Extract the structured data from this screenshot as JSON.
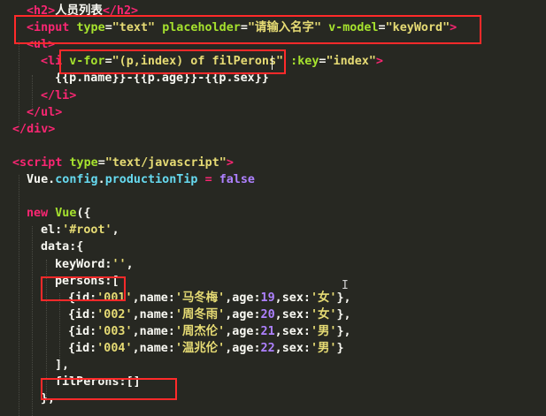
{
  "editor": {
    "lines": [
      [
        {
          "c": "tag",
          "t": "<h2>"
        },
        {
          "c": "plain",
          "t": "人员列表"
        },
        {
          "c": "tag",
          "t": "</h2>"
        }
      ],
      [
        {
          "c": "tag",
          "t": "<input"
        },
        {
          "c": "plain",
          "t": " "
        },
        {
          "c": "attr",
          "t": "type"
        },
        {
          "c": "plain",
          "t": "="
        },
        {
          "c": "str",
          "t": "\"text\""
        },
        {
          "c": "plain",
          "t": " "
        },
        {
          "c": "attr",
          "t": "placeholder"
        },
        {
          "c": "plain",
          "t": "="
        },
        {
          "c": "str",
          "t": "\"请输入名字\""
        },
        {
          "c": "plain",
          "t": " "
        },
        {
          "c": "attr",
          "t": "v-model"
        },
        {
          "c": "plain",
          "t": "="
        },
        {
          "c": "str",
          "t": "\"keyWord\""
        },
        {
          "c": "tag",
          "t": ">"
        }
      ],
      [
        {
          "c": "tag",
          "t": "<ul>"
        }
      ],
      [
        {
          "c": "tag",
          "t": "<li"
        },
        {
          "c": "plain",
          "t": " "
        },
        {
          "c": "attr",
          "t": "v-for"
        },
        {
          "c": "plain",
          "t": "="
        },
        {
          "c": "str",
          "t": "\"(p,index) of filPerons\""
        },
        {
          "c": "plain",
          "t": " "
        },
        {
          "c": "attr",
          "t": ":key"
        },
        {
          "c": "plain",
          "t": "="
        },
        {
          "c": "str",
          "t": "\"index\""
        },
        {
          "c": "tag",
          "t": ">"
        }
      ],
      [
        {
          "c": "plain",
          "t": "{{p.name}}-{{p.age}}-{{p.sex}}"
        }
      ],
      [
        {
          "c": "tag",
          "t": "</li>"
        }
      ],
      [
        {
          "c": "tag",
          "t": "</ul>"
        }
      ],
      [
        {
          "c": "tag",
          "t": "</div>"
        }
      ],
      [],
      [
        {
          "c": "tag",
          "t": "<script"
        },
        {
          "c": "plain",
          "t": " "
        },
        {
          "c": "attr",
          "t": "type"
        },
        {
          "c": "plain",
          "t": "="
        },
        {
          "c": "str",
          "t": "\"text/javascript\""
        },
        {
          "c": "tag",
          "t": ">"
        }
      ],
      [
        {
          "c": "plain",
          "t": "Vue."
        },
        {
          "c": "obj",
          "t": "config"
        },
        {
          "c": "plain",
          "t": "."
        },
        {
          "c": "obj",
          "t": "productionTip"
        },
        {
          "c": "plain",
          "t": " "
        },
        {
          "c": "kw",
          "t": "="
        },
        {
          "c": "plain",
          "t": " "
        },
        {
          "c": "num",
          "t": "false"
        }
      ],
      [],
      [
        {
          "c": "kw",
          "t": "new"
        },
        {
          "c": "plain",
          "t": " "
        },
        {
          "c": "fn",
          "t": "Vue"
        },
        {
          "c": "plain",
          "t": "({"
        }
      ],
      [
        {
          "c": "plain",
          "t": "el:"
        },
        {
          "c": "str",
          "t": "'#root'"
        },
        {
          "c": "plain",
          "t": ","
        }
      ],
      [
        {
          "c": "plain",
          "t": "data:{"
        }
      ],
      [
        {
          "c": "plain",
          "t": "keyWord:"
        },
        {
          "c": "str",
          "t": "''"
        },
        {
          "c": "plain",
          "t": ","
        }
      ],
      [
        {
          "c": "plain",
          "t": "persons:["
        }
      ],
      [
        {
          "c": "plain",
          "t": "{id:"
        },
        {
          "c": "str",
          "t": "'001'"
        },
        {
          "c": "plain",
          "t": ",name:"
        },
        {
          "c": "str",
          "t": "'马冬梅'"
        },
        {
          "c": "plain",
          "t": ",age:"
        },
        {
          "c": "num",
          "t": "19"
        },
        {
          "c": "plain",
          "t": ",sex:"
        },
        {
          "c": "str",
          "t": "'女'"
        },
        {
          "c": "plain",
          "t": "},"
        }
      ],
      [
        {
          "c": "plain",
          "t": "{id:"
        },
        {
          "c": "str",
          "t": "'002'"
        },
        {
          "c": "plain",
          "t": ",name:"
        },
        {
          "c": "str",
          "t": "'周冬雨'"
        },
        {
          "c": "plain",
          "t": ",age:"
        },
        {
          "c": "num",
          "t": "20"
        },
        {
          "c": "plain",
          "t": ",sex:"
        },
        {
          "c": "str",
          "t": "'女'"
        },
        {
          "c": "plain",
          "t": "},"
        }
      ],
      [
        {
          "c": "plain",
          "t": "{id:"
        },
        {
          "c": "str",
          "t": "'003'"
        },
        {
          "c": "plain",
          "t": ",name:"
        },
        {
          "c": "str",
          "t": "'周杰伦'"
        },
        {
          "c": "plain",
          "t": ",age:"
        },
        {
          "c": "num",
          "t": "21"
        },
        {
          "c": "plain",
          "t": ",sex:"
        },
        {
          "c": "str",
          "t": "'男'"
        },
        {
          "c": "plain",
          "t": "},"
        }
      ],
      [
        {
          "c": "plain",
          "t": "{id:"
        },
        {
          "c": "str",
          "t": "'004'"
        },
        {
          "c": "plain",
          "t": ",name:"
        },
        {
          "c": "str",
          "t": "'温兆伦'"
        },
        {
          "c": "plain",
          "t": ",age:"
        },
        {
          "c": "num",
          "t": "22"
        },
        {
          "c": "plain",
          "t": ",sex:"
        },
        {
          "c": "str",
          "t": "'男'"
        },
        {
          "c": "plain",
          "t": "}"
        }
      ],
      [
        {
          "c": "plain",
          "t": "],"
        }
      ],
      [
        {
          "c": "plain",
          "t": "filPerons:[]"
        }
      ],
      [
        {
          "c": "plain",
          "t": "},"
        }
      ]
    ]
  }
}
